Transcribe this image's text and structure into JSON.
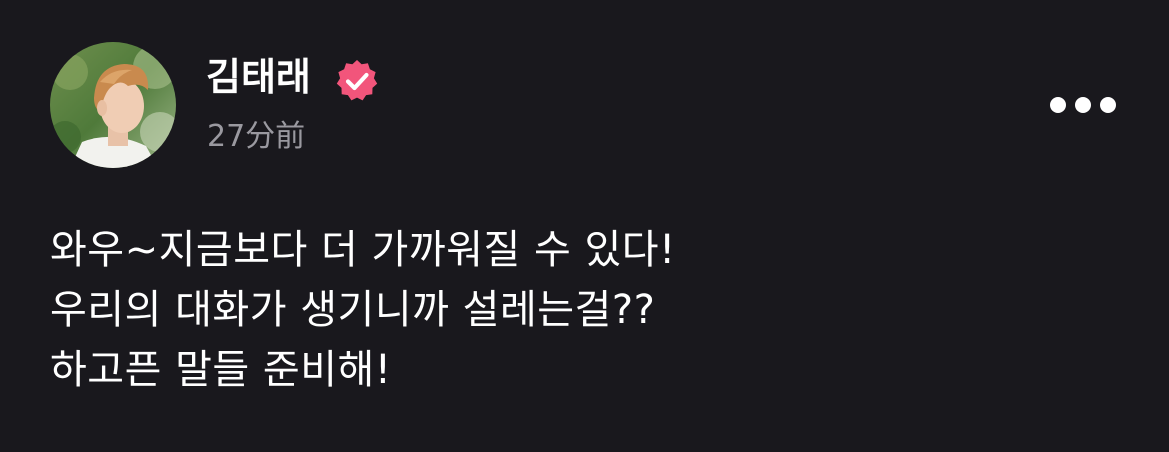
{
  "post": {
    "author": {
      "name": "김태래",
      "verified_badge_icon": "verified-check-badge-icon",
      "verified_badge_color": "#f2557b"
    },
    "timestamp": "27分前",
    "more_icon": "more-horizontal-icon",
    "body_lines": [
      "와우~지금보다 더 가까워질 수 있다!",
      "우리의 대화가 생기니까 설레는걸??",
      "하고픈 말들 준비해!"
    ]
  },
  "colors": {
    "background": "#19181d",
    "text_primary": "#ffffff",
    "text_secondary": "#9a99a0",
    "accent": "#f2557b"
  }
}
